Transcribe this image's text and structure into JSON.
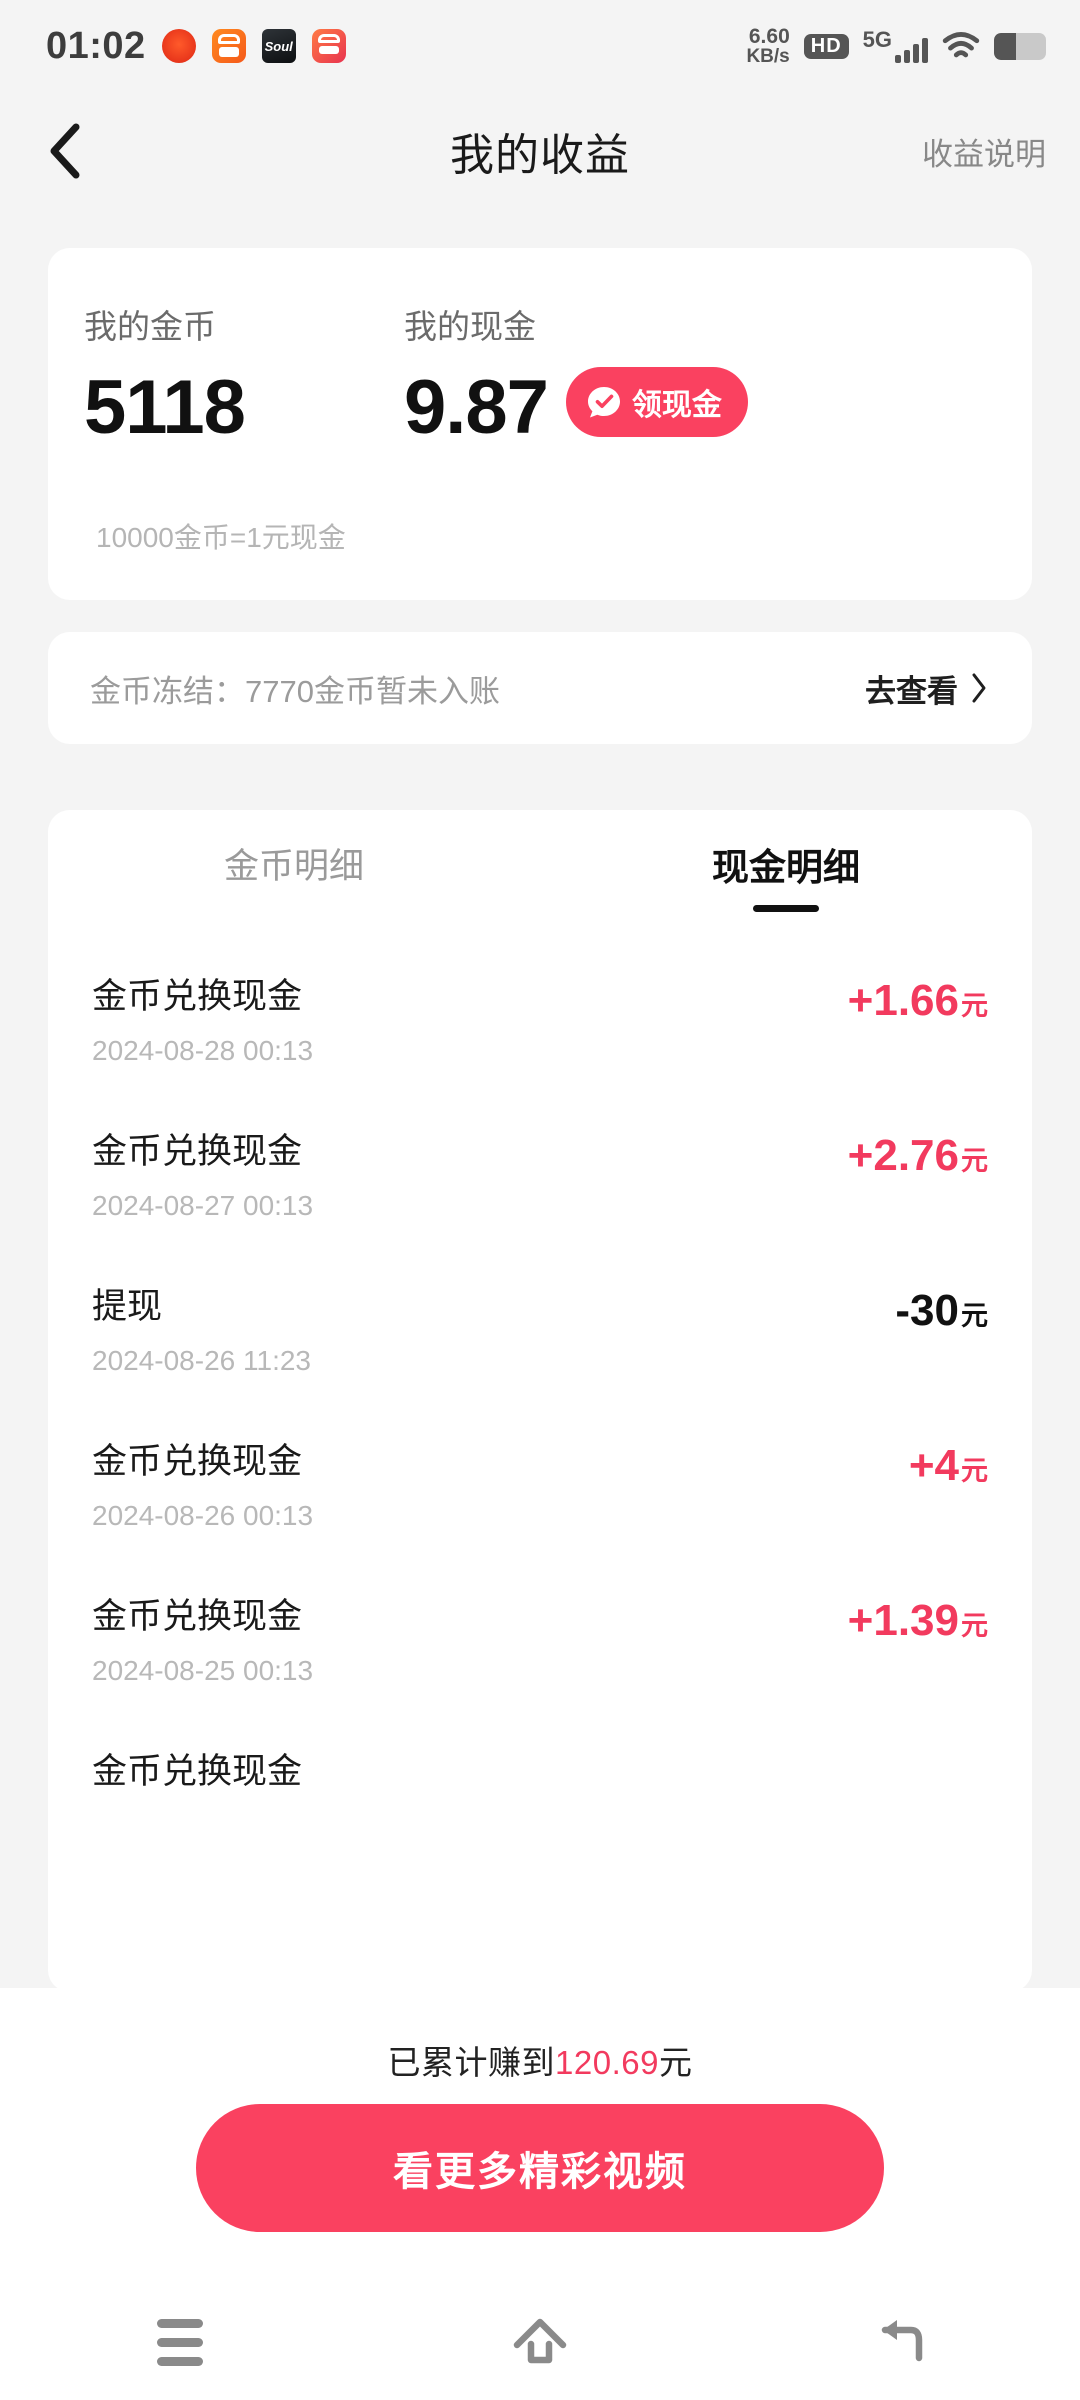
{
  "status_bar": {
    "time": "01:02",
    "network_speed": "6.60",
    "network_speed_unit": "KB/s",
    "hd_label": "HD",
    "network_type": "5G",
    "app_icons": [
      {
        "name": "app-icon-red-circle",
        "label": ""
      },
      {
        "name": "app-icon-kuaishou",
        "label": ""
      },
      {
        "name": "app-icon-soul",
        "label": "Soul"
      },
      {
        "name": "app-icon-kuaishou-extra",
        "label": ""
      }
    ]
  },
  "header": {
    "back_icon": "chevron-left-icon",
    "title": "我的收益",
    "right_link": "收益说明"
  },
  "balance": {
    "coins_label": "我的金币",
    "coins_value": "5118",
    "cash_label": "我的现金",
    "cash_value": "9.87",
    "claim_button": "领现金",
    "claim_icon": "check-bubble-icon",
    "rate_note": "10000金币=1元现金"
  },
  "frozen": {
    "text": "金币冻结：7770金币暂未入账",
    "link_label": "去查看",
    "chevron_icon": "chevron-right-icon"
  },
  "tabs": [
    {
      "label": "金币明细",
      "active": false
    },
    {
      "label": "现金明细",
      "active": true
    }
  ],
  "transactions": [
    {
      "title": "金币兑换现金",
      "date": "2024-08-28 00:13",
      "amount": "+1.66",
      "unit": "元",
      "positive": true
    },
    {
      "title": "金币兑换现金",
      "date": "2024-08-27 00:13",
      "amount": "+2.76",
      "unit": "元",
      "positive": true
    },
    {
      "title": "提现",
      "date": "2024-08-26 11:23",
      "amount": "-30",
      "unit": "元",
      "positive": false
    },
    {
      "title": "金币兑换现金",
      "date": "2024-08-26 00:13",
      "amount": "+4",
      "unit": "元",
      "positive": true
    },
    {
      "title": "金币兑换现金",
      "date": "2024-08-25 00:13",
      "amount": "+1.39",
      "unit": "元",
      "positive": true
    },
    {
      "title": "金币兑换现金",
      "date": "",
      "amount": "",
      "unit": "",
      "positive": true
    }
  ],
  "bottom": {
    "total_prefix": "已累计赚到",
    "total_amount": "120.69",
    "total_suffix": "元",
    "cta_label": "看更多精彩视频"
  },
  "navbar": {
    "recents_icon": "menu-icon",
    "home_icon": "home-icon",
    "back_icon": "back-arrow-icon"
  },
  "colors": {
    "accent_pink": "#FA4160",
    "amount_pink": "#F23A5E",
    "page_bg": "#F4F4F4"
  }
}
